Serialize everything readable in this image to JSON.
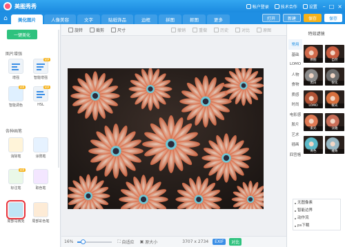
{
  "app": {
    "title": "美图秀秀"
  },
  "titlebar": {
    "account": "帐户登录",
    "support": "技术合作",
    "settings": "设置"
  },
  "tabs": [
    {
      "label": "美化图片",
      "active": true
    },
    {
      "label": "人像美容",
      "active": false
    },
    {
      "label": "文字",
      "active": false
    },
    {
      "label": "贴纸饰品",
      "active": false
    },
    {
      "label": "边框",
      "active": false
    },
    {
      "label": "拼图",
      "active": false
    },
    {
      "label": "抠图",
      "active": false
    },
    {
      "label": "更多",
      "active": false
    }
  ],
  "tab_actions": {
    "open": "打开",
    "new": "新建",
    "vip": "保存",
    "save": "保存"
  },
  "left": {
    "onekey": "一键美化",
    "section1": "图片增强",
    "section2": "各种画笔",
    "tools1": [
      {
        "label": "增强"
      },
      {
        "label": "智能增强"
      },
      {
        "label": "智能调色"
      },
      {
        "label": "HSL"
      }
    ],
    "tools2": [
      {
        "label": "消除笔"
      },
      {
        "label": "涂鸦笔"
      },
      {
        "label": "标注笔"
      },
      {
        "label": "取色笔"
      },
      {
        "label": "局部马赛克"
      },
      {
        "label": "局部彩色笔"
      }
    ]
  },
  "toolbar": {
    "rotate": "旋转",
    "crop": "裁剪",
    "size": "尺寸",
    "undo": "撤销",
    "redo": "重做",
    "history": "历史",
    "compare": "对比",
    "reset": "原图"
  },
  "bottombar": {
    "zoom": "16%",
    "fit": "自适应",
    "original": "原大小",
    "dims": "3707 x 2734",
    "exif": "EXIF",
    "compare": "对比"
  },
  "zoom_level": 0.16,
  "right": {
    "title": "特效滤镜",
    "categories": [
      "常用",
      "基础",
      "LOMO",
      "人物",
      "食物",
      "质感",
      "时尚",
      "电影感",
      "胶片",
      "艺术",
      "插画",
      "四宫格"
    ],
    "active_category": "常用",
    "filters": [
      {
        "label": "原图",
        "tone": "#d26a4a"
      },
      {
        "label": "自然",
        "tone": "#c95c3f"
      },
      {
        "label": "黑白",
        "tone": "#8a8a8a"
      },
      {
        "label": "锐化",
        "tone": "#6e6e6e"
      },
      {
        "label": "LOMO",
        "tone": "#b25335"
      },
      {
        "label": "暖光",
        "tone": "#d8703e"
      },
      {
        "label": "柔光",
        "tone": "#e07a54"
      },
      {
        "label": "淡雅",
        "tone": "#c96e58"
      },
      {
        "label": "青色",
        "tone": "#5ab9c8"
      },
      {
        "label": "雅致",
        "tone": "#97b7c3"
      }
    ],
    "recent": [
      "无图像素",
      "智能边界",
      "动作流",
      "ps下载"
    ]
  },
  "colors": {
    "brand": "#1f8fe3",
    "green": "#2ec27e",
    "vip": "#f6b21a",
    "highlight": "#e8323a"
  }
}
